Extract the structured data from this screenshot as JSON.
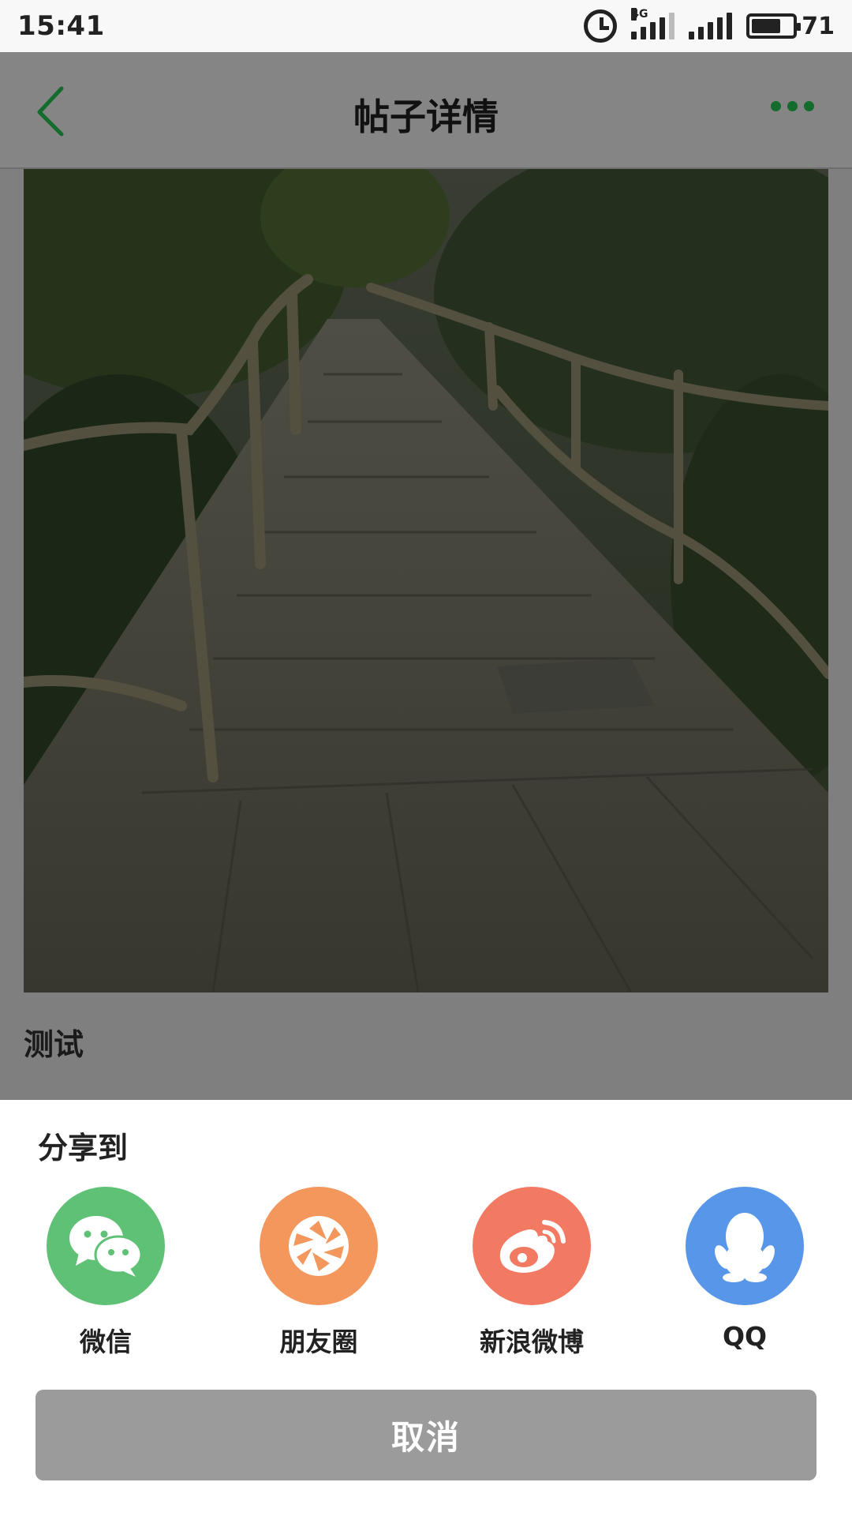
{
  "status_bar": {
    "time": "15:41",
    "network": "4G",
    "battery_level": "71"
  },
  "header": {
    "title": "帖子详情",
    "back_icon": "chevron-left-icon",
    "more_icon": "more-dots-icon",
    "accent_color": "#1a7a34"
  },
  "post": {
    "image": "wooden-boardwalk-photo",
    "text": "测试"
  },
  "share_sheet": {
    "title": "分享到",
    "targets": [
      {
        "label": "微信",
        "icon": "wechat-icon",
        "color": "#5fc176"
      },
      {
        "label": "朋友圈",
        "icon": "moments-icon",
        "color": "#f3975d"
      },
      {
        "label": "新浪微博",
        "icon": "weibo-icon",
        "color": "#f27a62"
      },
      {
        "label": "QQ",
        "icon": "qq-icon",
        "color": "#5796e8"
      }
    ],
    "cancel_label": "取消"
  }
}
